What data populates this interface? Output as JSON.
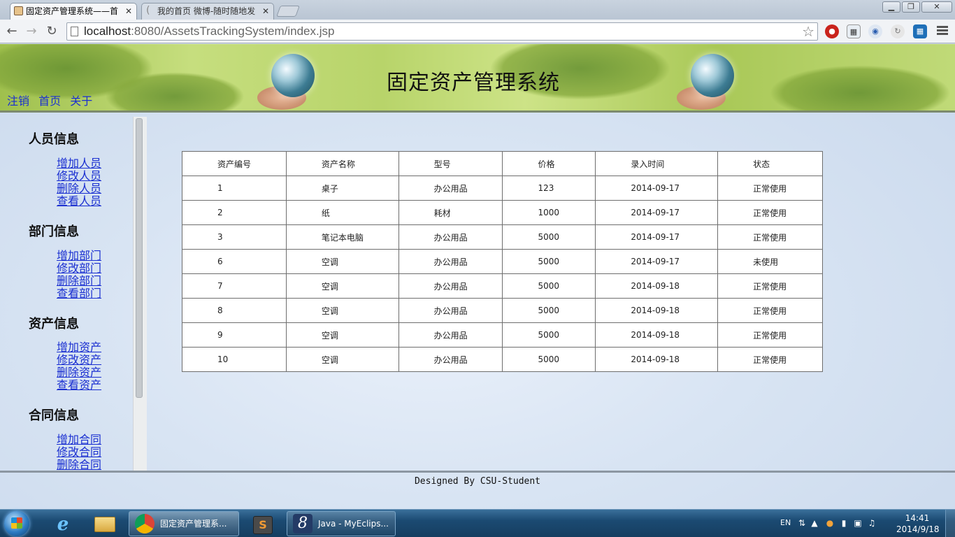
{
  "browser": {
    "tabs": [
      {
        "label": "固定资产管理系统——首",
        "active": true
      },
      {
        "label": "我的首页 微博-随时随地发",
        "active": false
      }
    ],
    "url_host": "localhost",
    "url_rest": ":8080/AssetsTrackingSystem/index.jsp",
    "window_controls": {
      "minimize": "▁",
      "restore": "❐",
      "close": "✕"
    }
  },
  "header": {
    "title": "固定资产管理系统",
    "links": [
      "注销",
      "首页",
      "关于"
    ]
  },
  "sidebar": {
    "groups": [
      {
        "title": "人员信息",
        "items": [
          "增加人员",
          "修改人员",
          "删除人员",
          "查看人员"
        ]
      },
      {
        "title": "部门信息",
        "items": [
          "增加部门",
          "修改部门",
          "删除部门",
          "查看部门"
        ]
      },
      {
        "title": "资产信息",
        "items": [
          "增加资产",
          "修改资产",
          "删除资产",
          "查看资产"
        ]
      },
      {
        "title": "合同信息",
        "items": [
          "增加合同",
          "修改合同",
          "删除合同"
        ]
      }
    ]
  },
  "table": {
    "columns": [
      "资产编号",
      "资产名称",
      "型号",
      "价格",
      "录入时间",
      "状态"
    ],
    "rows": [
      [
        "1",
        "桌子",
        "办公用品",
        "123",
        "2014-09-17",
        "正常使用"
      ],
      [
        "2",
        "纸",
        "耗材",
        "1000",
        "2014-09-17",
        "正常使用"
      ],
      [
        "3",
        "笔记本电脑",
        "办公用品",
        "5000",
        "2014-09-17",
        "正常使用"
      ],
      [
        "6",
        "空调",
        "办公用品",
        "5000",
        "2014-09-17",
        "未使用"
      ],
      [
        "7",
        "空调",
        "办公用品",
        "5000",
        "2014-09-18",
        "正常使用"
      ],
      [
        "8",
        "空调",
        "办公用品",
        "5000",
        "2014-09-18",
        "正常使用"
      ],
      [
        "9",
        "空调",
        "办公用品",
        "5000",
        "2014-09-18",
        "正常使用"
      ],
      [
        "10",
        "空调",
        "办公用品",
        "5000",
        "2014-09-18",
        "正常使用"
      ]
    ]
  },
  "footer": {
    "text": "Designed By CSU-Student"
  },
  "taskbar": {
    "tasks": [
      {
        "label": "固定资产管理系...",
        "icon": "chrome-icon"
      },
      {
        "label": "Java - MyEclips...",
        "icon": "myeclipse-icon"
      }
    ],
    "language": "EN",
    "time": "14:41",
    "date": "2014/9/18"
  },
  "colors": {
    "link": "#1a2fd1",
    "banner_green": "#b8d46a",
    "taskbar": "#1b4a72"
  }
}
